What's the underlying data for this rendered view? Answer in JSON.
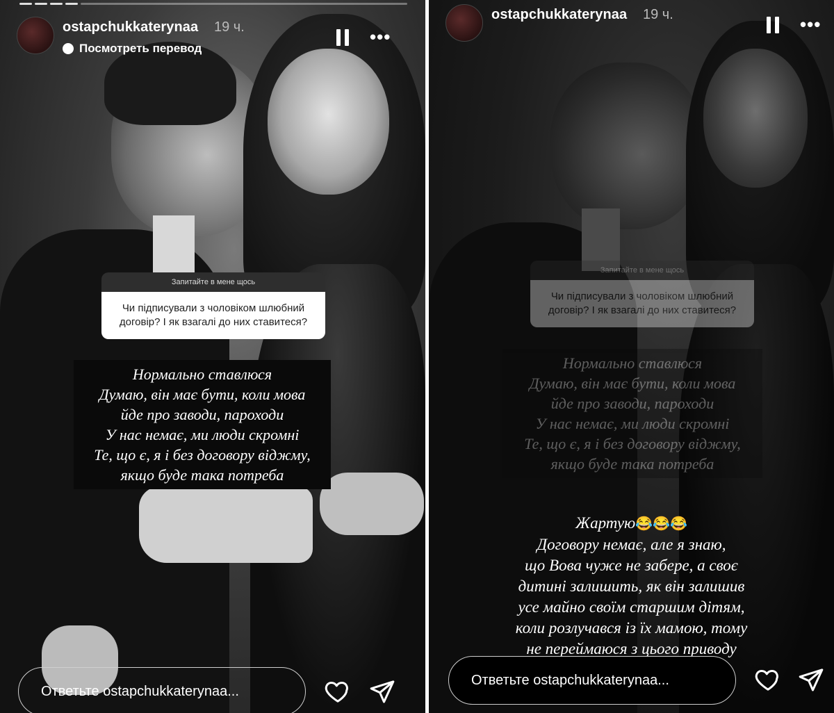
{
  "left": {
    "username": "ostapchukkaterynaa",
    "time": "19 ч.",
    "translate_label": "Посмотреть перевод",
    "question_header": "Запитайте в мене щось",
    "question_text": "Чи підписували з чоловіком шлюбний договір? І як взагалі до них ставитеся?",
    "answer_lines": [
      "Нормально ставлюся",
      "Думаю, він має бути, коли мова",
      "йде про заводи, пароходи",
      "У нас немає, ми люди скромні",
      "Те, що є, я і без договору віджму,",
      "якщо буде така потреба"
    ],
    "reply_placeholder": "Ответьте ostapchukkaterynaa..."
  },
  "right": {
    "username": "ostapchukkaterynaa",
    "time": "19 ч.",
    "question_header": "Запитайте в мене щось",
    "question_text": "Чи підписували з чоловіком шлюбний договір? І як взагалі до них ставитеся?",
    "answer_lines": [
      "Нормально ставлюся",
      "Думаю, він має бути, коли мова",
      "йде про заводи, пароходи",
      "У нас немає, ми люди скромні",
      "Те, що є, я і без договору віджму,",
      "якщо буде така потреба"
    ],
    "joke_word": "Жартую",
    "joke_emoji": "😂😂😂",
    "joke_lines": [
      "Договору немає, але я знаю,",
      "що Вова чуже не забере, а своє",
      "дитині залишить, як він залишив",
      "усе майно своїм старшим дітям,",
      "коли розлучався із їх мамою, тому",
      "не переймаюся з цього приводу"
    ],
    "reply_placeholder": "Ответьте ostapchukkaterynaa..."
  },
  "icons": {
    "pause": "pause-icon",
    "more": "more-icon",
    "heart": "heart-icon",
    "send": "send-icon",
    "translate": "translate-icon"
  }
}
